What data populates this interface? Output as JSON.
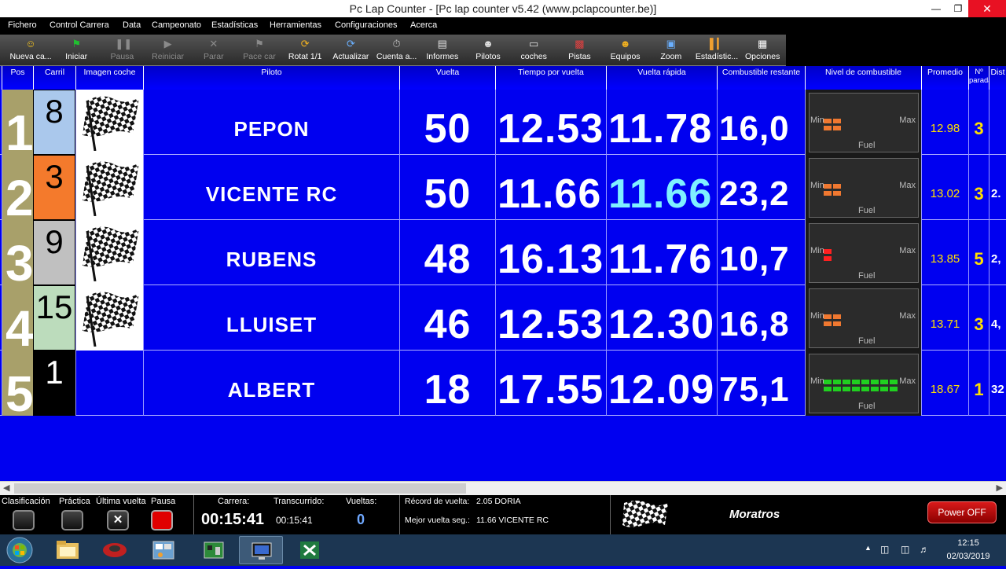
{
  "window": {
    "title": "Pc Lap Counter - [Pc lap counter v5.42 (www.pclapcounter.be)]"
  },
  "menu": [
    "Fichero",
    "Control Carrera",
    "Data",
    "Campeonato",
    "Estadísticas",
    "Herramientas",
    "Configuraciones",
    "Acerca"
  ],
  "toolbar": [
    {
      "label": "Nueva ca...",
      "icon": "new-race-icon",
      "enabled": true
    },
    {
      "label": "Iniciar",
      "icon": "start-flag-icon",
      "enabled": true
    },
    {
      "label": "Pausa",
      "icon": "pause-icon",
      "enabled": false
    },
    {
      "label": "Reiniciar",
      "icon": "restart-icon",
      "enabled": false
    },
    {
      "label": "Parar",
      "icon": "stop-icon",
      "enabled": false
    },
    {
      "label": "Pace car",
      "icon": "pace-car-icon",
      "enabled": false
    },
    {
      "label": "Rotat 1/1",
      "icon": "rotate-icon",
      "enabled": true
    },
    {
      "label": "Actualizar",
      "icon": "refresh-icon",
      "enabled": true
    },
    {
      "label": "Cuenta a...",
      "icon": "countdown-icon",
      "enabled": true
    },
    {
      "label": "Informes",
      "icon": "reports-icon",
      "enabled": true
    },
    {
      "label": "Pilotos",
      "icon": "drivers-icon",
      "enabled": true
    },
    {
      "label": "coches",
      "icon": "cars-icon",
      "enabled": true
    },
    {
      "label": "Pistas",
      "icon": "tracks-icon",
      "enabled": true
    },
    {
      "label": "Equipos",
      "icon": "teams-icon",
      "enabled": true
    },
    {
      "label": "Zoom",
      "icon": "zoom-icon",
      "enabled": true
    },
    {
      "label": "Estadístic...",
      "icon": "statistics-icon",
      "enabled": true
    },
    {
      "label": "Opciones",
      "icon": "options-icon",
      "enabled": true
    }
  ],
  "columns": [
    "Pos",
    "Carril",
    "Imagen coche",
    "Piloto",
    "Vuelta",
    "Tiempo por vuelta",
    "Vuelta rápida",
    "Combustible restante",
    "Nivel de combustible",
    "Promedio",
    "Nº\nparada",
    "Dist"
  ],
  "rows": [
    {
      "pos": "1",
      "lane": "8",
      "lane_color": "#aac8ec",
      "has_image": true,
      "pilot": "PEPON",
      "laps": "50",
      "lap_time": "12.53",
      "best": "11.78",
      "best_highlight": false,
      "fuel_left": "16,0",
      "fuel_level": 0.2,
      "fuel_color": "#f07830",
      "avg": "12.98",
      "stops": "3",
      "dist": ""
    },
    {
      "pos": "2",
      "lane": "3",
      "lane_color": "#f47a2c",
      "has_image": true,
      "pilot": "VICENTE RC",
      "laps": "50",
      "lap_time": "11.66",
      "best": "11.66",
      "best_highlight": true,
      "fuel_left": "23,2",
      "fuel_level": 0.2,
      "fuel_color": "#f07830",
      "avg": "13.02",
      "stops": "3",
      "dist": "2."
    },
    {
      "pos": "3",
      "lane": "9",
      "lane_color": "#c0c0c0",
      "has_image": true,
      "pilot": "RUBENS",
      "laps": "48",
      "lap_time": "16.13",
      "best": "11.76",
      "best_highlight": false,
      "fuel_left": "10,7",
      "fuel_level": 0.1,
      "fuel_color": "#ff2020",
      "avg": "13.85",
      "stops": "5",
      "dist": "2,"
    },
    {
      "pos": "4",
      "lane": "15",
      "lane_color": "#bcdcbc",
      "has_image": true,
      "pilot": "LLUISET",
      "laps": "46",
      "lap_time": "12.53",
      "best": "12.30",
      "best_highlight": false,
      "fuel_left": "16,8",
      "fuel_level": 0.2,
      "fuel_color": "#f07830",
      "avg": "13.71",
      "stops": "3",
      "dist": "4,"
    },
    {
      "pos": "5",
      "lane": "1",
      "lane_color": "#000000",
      "has_image": false,
      "pilot": "ALBERT",
      "laps": "18",
      "lap_time": "17.55",
      "best": "12.09",
      "best_highlight": false,
      "fuel_left": "75,1",
      "fuel_level": 0.75,
      "fuel_color": "#20d020",
      "avg": "18.67",
      "stops": "1",
      "dist": "32"
    }
  ],
  "gauge": {
    "min_label": "Min",
    "max_label": "Max",
    "fuel_label": "Fuel"
  },
  "status": {
    "buttons": [
      {
        "label": "Clasificación",
        "style": "dark"
      },
      {
        "label": "Práctica",
        "style": "dark"
      },
      {
        "label": "Última vuelta",
        "style": "x"
      },
      {
        "label": "Pausa",
        "style": "red"
      }
    ],
    "race_label": "Carrera:",
    "race_time": "00:15:41",
    "elapsed_label": "Transcurrido:",
    "elapsed_time": "00:15:41",
    "laps_label": "Vueltas:",
    "laps_value": "0",
    "record_label": "Récord de vuelta:",
    "record_value": "2.05 DORIA",
    "best_label": "Mejor vuelta seg.:",
    "best_value": "11.66 VICENTE RC",
    "team": "Moratros",
    "power": "Power OFF"
  },
  "taskbar": {
    "time": "12:15",
    "date": "02/03/2019"
  },
  "colors": {
    "background": "#0000f0",
    "yellow": "#ffe000",
    "highlight": "#7ff0ff"
  }
}
